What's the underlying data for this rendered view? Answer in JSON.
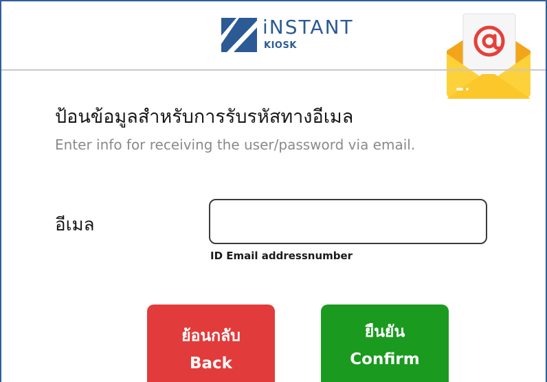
{
  "header": {
    "logo_main": "iNSTANT",
    "logo_sub": "KIOSK",
    "mail_icon": "email-at-envelope-icon",
    "brand_color": "#2b5a94"
  },
  "form": {
    "title_th": "ป้อนข้อมูลสำหรับการรับรหัสทางอีเมล",
    "subtitle_en": "Enter info for receiving the user/password via email.",
    "email_label": "อีเมล",
    "email_value": "",
    "email_hint": "ID Email addressnumber"
  },
  "buttons": {
    "back_th": "ย้อนกลับ",
    "back_en": "Back",
    "back_color": "#e23b3b",
    "confirm_th": "ยืนยัน",
    "confirm_en": "Confirm",
    "confirm_color": "#1a9a1e"
  }
}
